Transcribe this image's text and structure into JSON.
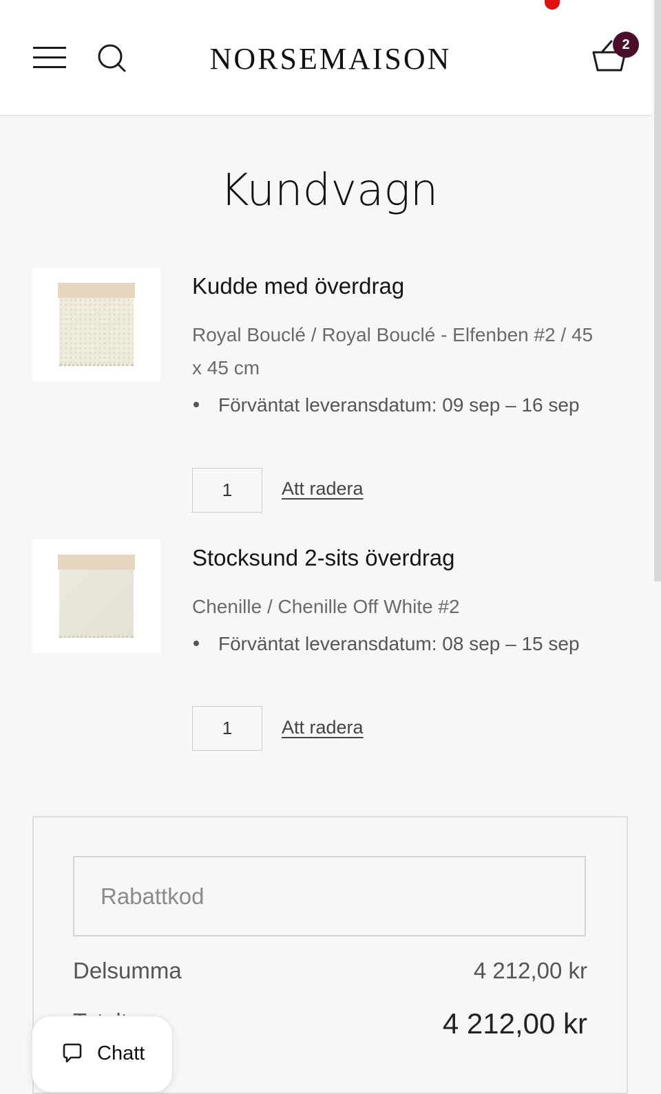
{
  "header": {
    "logo": "NORSEMAISON",
    "menu_icon": "hamburger-menu-icon",
    "search_icon": "search-icon",
    "cart_icon": "shopping-basket-icon",
    "cart_count": "2"
  },
  "colors": {
    "badge": "#4a0d2a",
    "background": "#f7f7f7",
    "header_bg": "#ffffff"
  },
  "page": {
    "title": "Kundvagn"
  },
  "items": [
    {
      "title": "Kudde med överdrag",
      "variant": "Royal Bouclé / Royal Bouclé - Elfenben #2 / 45 x 45 cm",
      "delivery": "Förväntat leveransdatum: 09 sep – 16 sep",
      "quantity": "1",
      "remove_label": "Att radera"
    },
    {
      "title": "Stocksund 2-sits överdrag",
      "variant": "Chenille / Chenille Off White #2",
      "delivery": "Förväntat leveransdatum: 08 sep – 15 sep",
      "quantity": "1",
      "remove_label": "Att radera"
    }
  ],
  "summary": {
    "discount_placeholder": "Rabattkod",
    "subtotal_label": "Delsumma",
    "subtotal_value": "4 212,00 kr",
    "total_label": "Totalt",
    "total_value": "4 212,00 kr"
  },
  "chat": {
    "label": "Chatt",
    "icon": "chat-bubble-icon"
  }
}
